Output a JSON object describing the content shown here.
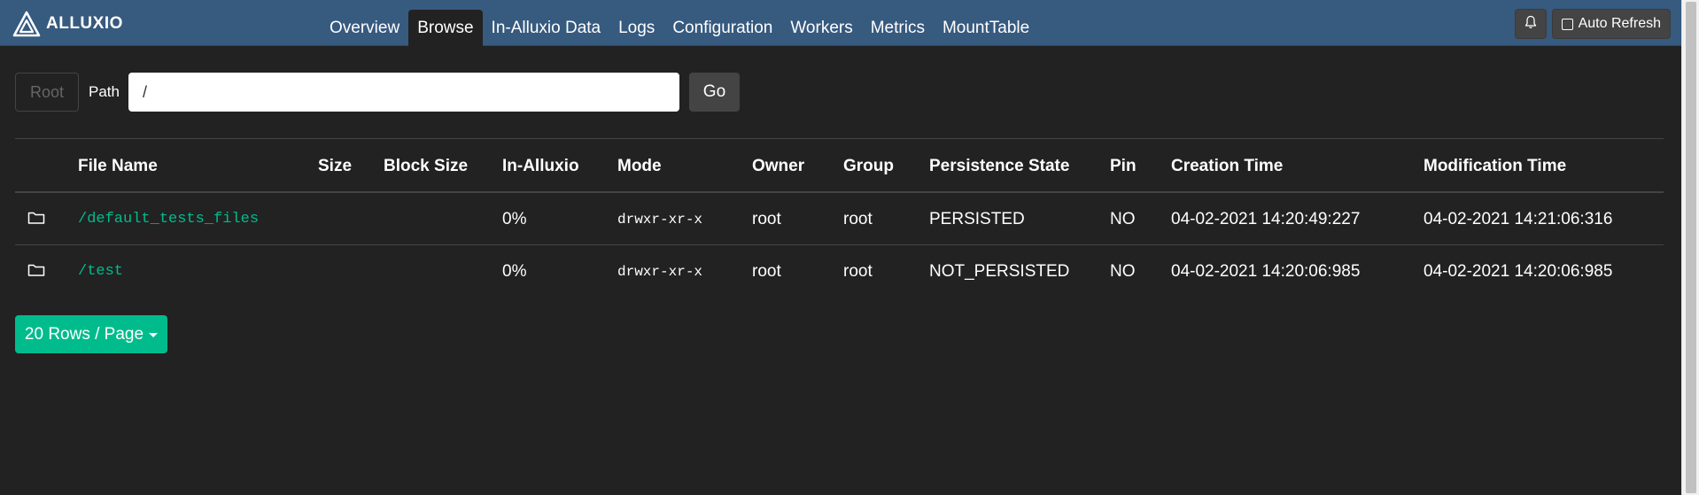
{
  "brand": {
    "name": "ALLUXIO",
    "logo_icon": "alluxio-logo-icon"
  },
  "nav": {
    "tabs": [
      {
        "label": "Overview",
        "active": false
      },
      {
        "label": "Browse",
        "active": true
      },
      {
        "label": "In-Alluxio Data",
        "active": false
      },
      {
        "label": "Logs",
        "active": false
      },
      {
        "label": "Configuration",
        "active": false
      },
      {
        "label": "Workers",
        "active": false
      },
      {
        "label": "Metrics",
        "active": false
      },
      {
        "label": "MountTable",
        "active": false
      }
    ],
    "bell_icon": "bell-icon",
    "auto_refresh_label": "Auto Refresh",
    "auto_refresh_checked": false
  },
  "path_bar": {
    "root_label": "Root",
    "path_label": "Path",
    "path_value": "/",
    "go_label": "Go"
  },
  "table": {
    "columns": [
      "File Name",
      "Size",
      "Block Size",
      "In-Alluxio",
      "Mode",
      "Owner",
      "Group",
      "Persistence State",
      "Pin",
      "Creation Time",
      "Modification Time"
    ],
    "rows": [
      {
        "icon": "folder-icon",
        "file_name": "/default_tests_files",
        "size": "",
        "block_size": "",
        "in_alluxio": "0%",
        "mode": "drwxr-xr-x",
        "owner": "root",
        "group": "root",
        "persistence_state": "PERSISTED",
        "pin": "NO",
        "creation_time": "04-02-2021 14:20:49:227",
        "modification_time": "04-02-2021 14:21:06:316"
      },
      {
        "icon": "folder-icon",
        "file_name": "/test",
        "size": "",
        "block_size": "",
        "in_alluxio": "0%",
        "mode": "drwxr-xr-x",
        "owner": "root",
        "group": "root",
        "persistence_state": "NOT_PERSISTED",
        "pin": "NO",
        "creation_time": "04-02-2021 14:20:06:985",
        "modification_time": "04-02-2021 14:20:06:985"
      }
    ]
  },
  "pagination": {
    "rows_per_page_label": "20 Rows / Page"
  },
  "colors": {
    "navbar": "#375a7f",
    "background": "#222222",
    "accent": "#00bc8c",
    "button": "#444444"
  }
}
